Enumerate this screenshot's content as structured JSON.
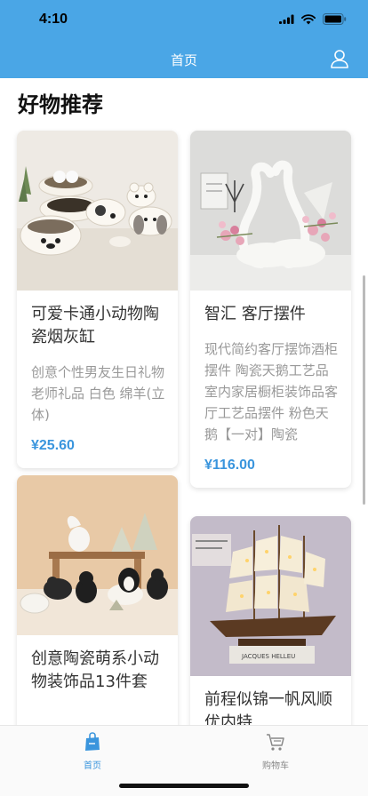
{
  "status": {
    "time": "4:10"
  },
  "nav": {
    "title": "首页"
  },
  "section": {
    "title": "好物推荐"
  },
  "products": [
    {
      "title": "可爱卡通小动物陶瓷烟灰缸",
      "desc": "创意个性男友生日礼物老师礼品 白色 绵羊(立体)",
      "price": "¥25.60"
    },
    {
      "title": "智汇 客厅摆件",
      "desc": "现代简约客厅摆饰酒柜摆件 陶瓷天鹅工艺品室内家居橱柜装饰品客厅工艺品摆件 粉色天鹅【一对】陶瓷",
      "price": "¥116.00"
    },
    {
      "title": "创意陶瓷萌系小动物装饰品13件套",
      "desc": "",
      "price": ""
    },
    {
      "title": "前程似锦一帆风顺 优内特",
      "desc": "",
      "price": ""
    }
  ],
  "tabs": [
    {
      "label": "首页"
    },
    {
      "label": "购物车"
    }
  ],
  "colors": {
    "accent": "#4aa6e6",
    "price": "#3a95dd",
    "tab_active": "#3a95dd",
    "tab_inactive": "#888888"
  }
}
